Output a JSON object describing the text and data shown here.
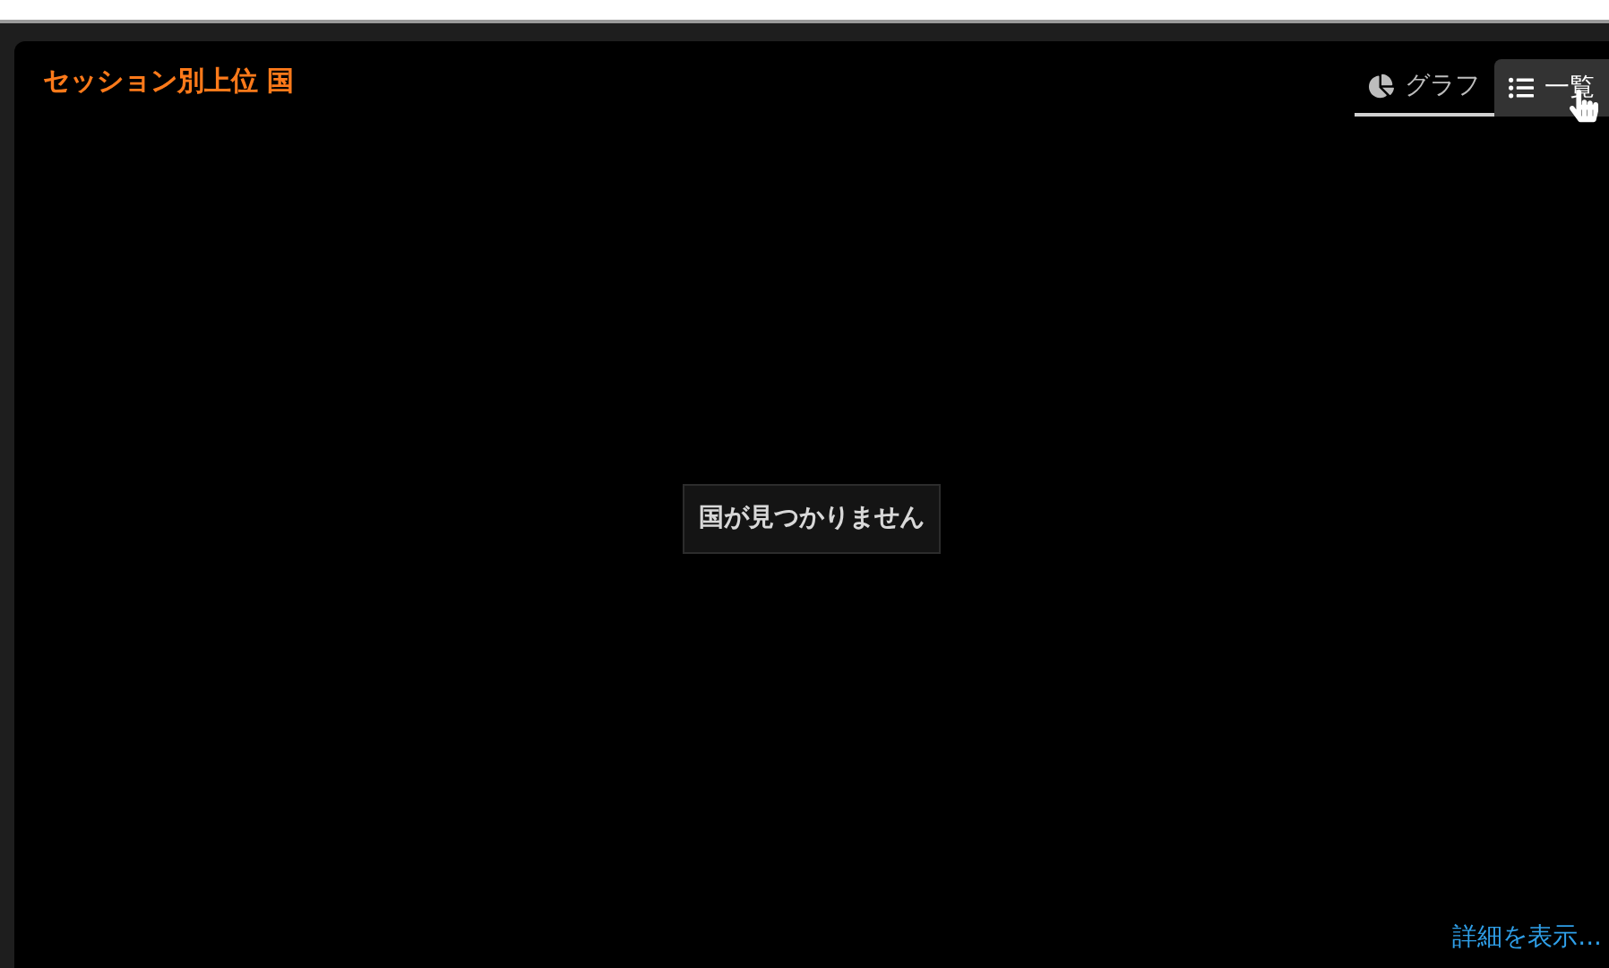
{
  "panel": {
    "title": "セッション別上位 国"
  },
  "tabs": [
    {
      "label": "グラフ",
      "kind": "chart",
      "selected": true,
      "hovered": false
    },
    {
      "label": "一覧",
      "kind": "list",
      "selected": false,
      "hovered": true
    }
  ],
  "empty_message": "国が見つかりません",
  "more_link": "詳細を表示..."
}
